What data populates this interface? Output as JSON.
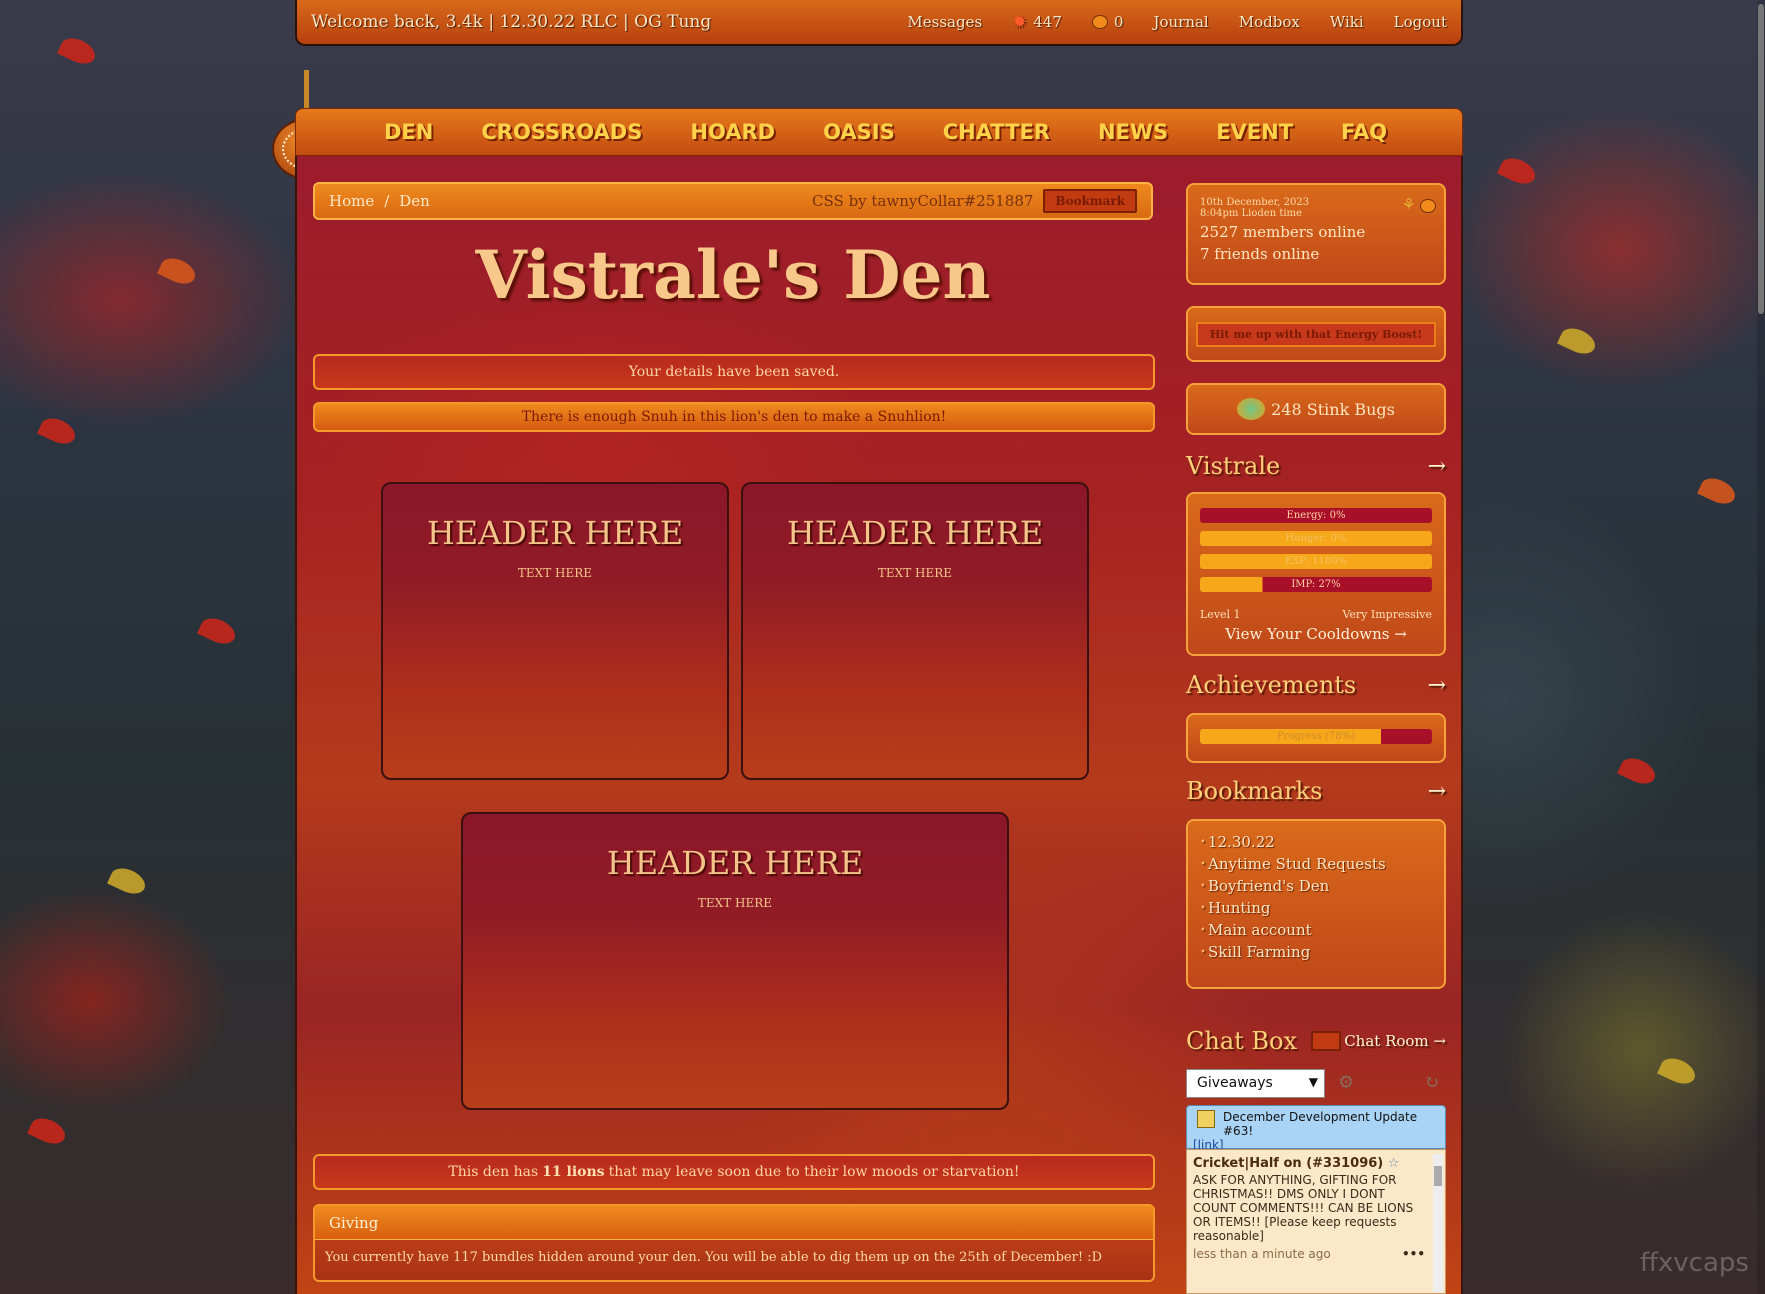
{
  "topbar": {
    "welcome": "Welcome back, 3.4k | 12.30.22 RLC | OG Tung",
    "messages": "Messages",
    "currency1": "447",
    "currency2": "0",
    "journal": "Journal",
    "modbox": "Modbox",
    "wiki": "Wiki",
    "logout": "Logout"
  },
  "nav": [
    "DEN",
    "CROSSROADS",
    "HOARD",
    "OASIS",
    "CHATTER",
    "NEWS",
    "EVENT",
    "FAQ"
  ],
  "breadcrumb": {
    "home": "Home",
    "sep": "/",
    "den": "Den",
    "css_credit": "CSS by tawnyCollar#251887",
    "bookmark_button": "Bookmark"
  },
  "den_title": "Vistrale's Den",
  "notices": {
    "saved": "Your details have been saved.",
    "snuh": "There is enough Snuh in this lion's den to make a Snuhlion!",
    "leave_pre": "This den has ",
    "leave_bold": "11 lions",
    "leave_post": " that may leave soon due to their low moods or starvation!"
  },
  "boxes": [
    {
      "header": "HEADER HERE",
      "text": "TEXT HERE"
    },
    {
      "header": "HEADER HERE",
      "text": "TEXT HERE"
    },
    {
      "header": "HEADER HERE",
      "text": "TEXT HERE"
    }
  ],
  "giving": {
    "title": "Giving",
    "text": "You currently have 117 bundles hidden around your den. You will be able to dig them up on the 25th of December! :D"
  },
  "status": {
    "date": "10th December, 2023",
    "time": "8:04pm Lioden time",
    "members_online": "2527 members online",
    "friends_online": "7 friends online"
  },
  "energy_boost": "Hit me up with that Energy Boost!",
  "stink_bugs": "248 Stink Bugs",
  "lion": {
    "name": "Vistrale",
    "energy": "Energy: 0%",
    "energy_value": 0,
    "hunger": "Hunger: 0%",
    "hunger_value": 0,
    "exp": "EXP: 1180%",
    "imp": "IMP: 27%",
    "imp_value": 27,
    "level": "Level 1",
    "impressive": "Very Impressive",
    "cooldowns": "View Your Cooldowns →"
  },
  "achievements": {
    "title": "Achievements",
    "progress": "Progress (78%)",
    "progress_value": 78
  },
  "bookmarks": {
    "title": "Bookmarks",
    "items": [
      "12.30.22",
      "Anytime Stud Requests",
      "Boyfriend's Den",
      "Hunting",
      "Main account",
      "Skill Farming"
    ]
  },
  "chat": {
    "title": "Chat Box",
    "room_link": "Chat Room →",
    "select_value": "Giveaways",
    "announcement": "December Development Update #63!",
    "announcement_link": "[link]",
    "user": "Cricket|Half on (#331096)",
    "message": "ASK FOR ANYTHING, GIFTING FOR CHRISTMAS!! DMS ONLY I DONT COUNT COMMENTS!!! CAN BE LIONS OR ITEMS!! [Please keep requests reasonable]",
    "time": "less than a minute ago",
    "more": "•••"
  },
  "arrow": "→",
  "watermark": "ffxvcaps"
}
